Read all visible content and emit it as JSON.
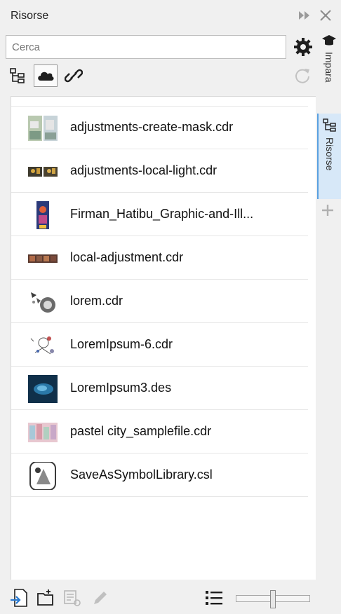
{
  "panel": {
    "title": "Risorse"
  },
  "search": {
    "placeholder": "Cerca"
  },
  "files": [
    {
      "name": "adjustments-create-mask.cdr",
      "thumb": "photo-grid"
    },
    {
      "name": "adjustments-local-light.cdr",
      "thumb": "photo-pair"
    },
    {
      "name": "Firman_Hatibu_Graphic-and-Ill...",
      "thumb": "poster"
    },
    {
      "name": "local-adjustment.cdr",
      "thumb": "photo-strip"
    },
    {
      "name": "lorem.cdr",
      "thumb": "illustration"
    },
    {
      "name": "LoremIpsum-6.cdr",
      "thumb": "sketch"
    },
    {
      "name": "LoremIpsum3.des",
      "thumb": "blue-image"
    },
    {
      "name": "pastel city_samplefile.cdr",
      "thumb": "city"
    },
    {
      "name": "SaveAsSymbolLibrary.csl",
      "thumb": "symbol-library-icon"
    }
  ],
  "side_tabs": [
    {
      "label": "Impara",
      "icon": "graduation-cap-icon"
    },
    {
      "label": "Risorse",
      "icon": "tree-view-icon"
    }
  ],
  "colors": {
    "panel_bg": "#f0f0f0",
    "active_tab": "#d7e8f8",
    "accent": "#5aa0e0"
  },
  "slider": {
    "level": 0.5
  }
}
